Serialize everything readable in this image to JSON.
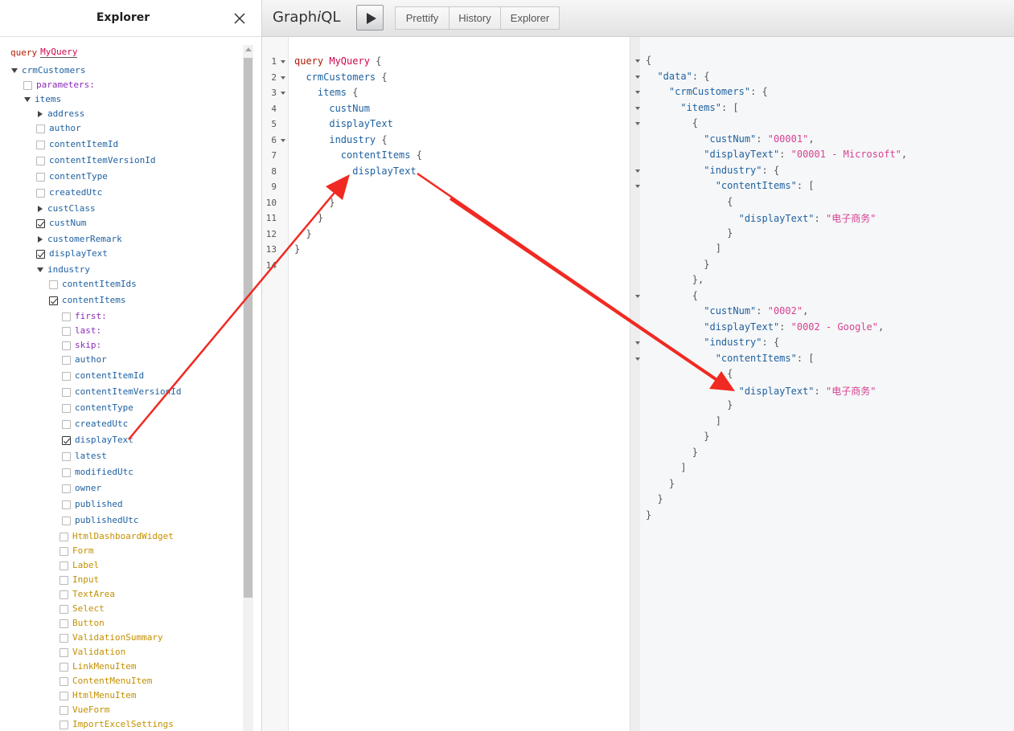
{
  "explorer": {
    "title": "Explorer",
    "query_keyword": "query",
    "query_name": "MyQuery",
    "tree": [
      {
        "label": "crmCustomers",
        "kind": "root-open",
        "depth": 0
      },
      {
        "label": "parameters:",
        "kind": "arg",
        "depth": 1,
        "checked": false
      },
      {
        "label": "items",
        "kind": "open",
        "depth": 1
      },
      {
        "label": "address",
        "kind": "closed",
        "depth": 2
      },
      {
        "label": "author",
        "kind": "field",
        "depth": 2,
        "checked": false
      },
      {
        "label": "contentItemId",
        "kind": "field",
        "depth": 2,
        "checked": false
      },
      {
        "label": "contentItemVersionId",
        "kind": "field",
        "depth": 2,
        "checked": false
      },
      {
        "label": "contentType",
        "kind": "field",
        "depth": 2,
        "checked": false
      },
      {
        "label": "createdUtc",
        "kind": "field",
        "depth": 2,
        "checked": false
      },
      {
        "label": "custClass",
        "kind": "closed",
        "depth": 2
      },
      {
        "label": "custNum",
        "kind": "field",
        "depth": 2,
        "checked": true
      },
      {
        "label": "customerRemark",
        "kind": "closed",
        "depth": 2
      },
      {
        "label": "displayText",
        "kind": "field",
        "depth": 2,
        "checked": true
      },
      {
        "label": "industry",
        "kind": "open",
        "depth": 2
      },
      {
        "label": "contentItemIds",
        "kind": "field",
        "depth": 3,
        "checked": false
      },
      {
        "label": "contentItems",
        "kind": "field",
        "depth": 3,
        "checked": true
      },
      {
        "label": "first:",
        "kind": "arg",
        "depth": 4,
        "checked": false
      },
      {
        "label": "last:",
        "kind": "arg",
        "depth": 4,
        "checked": false
      },
      {
        "label": "skip:",
        "kind": "arg",
        "depth": 4,
        "checked": false
      },
      {
        "label": "author",
        "kind": "field",
        "depth": 4,
        "checked": false
      },
      {
        "label": "contentItemId",
        "kind": "field",
        "depth": 4,
        "checked": false
      },
      {
        "label": "contentItemVersionId",
        "kind": "field",
        "depth": 4,
        "checked": false
      },
      {
        "label": "contentType",
        "kind": "field",
        "depth": 4,
        "checked": false
      },
      {
        "label": "createdUtc",
        "kind": "field",
        "depth": 4,
        "checked": false
      },
      {
        "label": "displayText",
        "kind": "field",
        "depth": 4,
        "checked": true
      },
      {
        "label": "latest",
        "kind": "field",
        "depth": 4,
        "checked": false
      },
      {
        "label": "modifiedUtc",
        "kind": "field",
        "depth": 4,
        "checked": false
      },
      {
        "label": "owner",
        "kind": "field",
        "depth": 4,
        "checked": false
      },
      {
        "label": "published",
        "kind": "field",
        "depth": 4,
        "checked": false
      },
      {
        "label": "publishedUtc",
        "kind": "field",
        "depth": 4,
        "checked": false
      },
      {
        "label": "HtmlDashboardWidget",
        "kind": "frag",
        "depth": 3,
        "checked": false
      },
      {
        "label": "Form",
        "kind": "frag",
        "depth": 3,
        "checked": false
      },
      {
        "label": "Label",
        "kind": "frag",
        "depth": 3,
        "checked": false
      },
      {
        "label": "Input",
        "kind": "frag",
        "depth": 3,
        "checked": false
      },
      {
        "label": "TextArea",
        "kind": "frag",
        "depth": 3,
        "checked": false
      },
      {
        "label": "Select",
        "kind": "frag",
        "depth": 3,
        "checked": false
      },
      {
        "label": "Button",
        "kind": "frag",
        "depth": 3,
        "checked": false
      },
      {
        "label": "ValidationSummary",
        "kind": "frag",
        "depth": 3,
        "checked": false
      },
      {
        "label": "Validation",
        "kind": "frag",
        "depth": 3,
        "checked": false
      },
      {
        "label": "LinkMenuItem",
        "kind": "frag",
        "depth": 3,
        "checked": false
      },
      {
        "label": "ContentMenuItem",
        "kind": "frag",
        "depth": 3,
        "checked": false
      },
      {
        "label": "HtmlMenuItem",
        "kind": "frag",
        "depth": 3,
        "checked": false
      },
      {
        "label": "VueForm",
        "kind": "frag",
        "depth": 3,
        "checked": false
      },
      {
        "label": "ImportExcelSettings",
        "kind": "frag",
        "depth": 3,
        "checked": false
      }
    ]
  },
  "toolbar": {
    "brand_prefix": "Graph",
    "brand_italic": "i",
    "brand_suffix": "QL",
    "prettify_label": "Prettify",
    "history_label": "History",
    "explorer_label": "Explorer"
  },
  "editor": {
    "line_numbers": [
      "1",
      "2",
      "3",
      "4",
      "5",
      "6",
      "7",
      "8",
      "9",
      "10",
      "11",
      "12",
      "13",
      "14"
    ],
    "lines": [
      [
        {
          "t": "query",
          "c": "kw"
        },
        {
          "t": " ",
          "c": "punc"
        },
        {
          "t": "MyQuery",
          "c": "def"
        },
        {
          "t": " {",
          "c": "punc"
        }
      ],
      [
        {
          "t": "  ",
          "c": "punc"
        },
        {
          "t": "crmCustomers",
          "c": "prop"
        },
        {
          "t": " {",
          "c": "punc"
        }
      ],
      [
        {
          "t": "    ",
          "c": "punc"
        },
        {
          "t": "items",
          "c": "prop"
        },
        {
          "t": " {",
          "c": "punc"
        }
      ],
      [
        {
          "t": "      ",
          "c": "punc"
        },
        {
          "t": "custNum",
          "c": "prop"
        }
      ],
      [
        {
          "t": "      ",
          "c": "punc"
        },
        {
          "t": "displayText",
          "c": "prop"
        }
      ],
      [
        {
          "t": "      ",
          "c": "punc"
        },
        {
          "t": "industry",
          "c": "prop"
        },
        {
          "t": " {",
          "c": "punc"
        }
      ],
      [
        {
          "t": "        ",
          "c": "punc"
        },
        {
          "t": "contentItems",
          "c": "prop"
        },
        {
          "t": " {",
          "c": "punc"
        }
      ],
      [
        {
          "t": "          ",
          "c": "punc"
        },
        {
          "t": "displayText",
          "c": "prop"
        }
      ],
      [
        {
          "t": "        }",
          "c": "punc"
        }
      ],
      [
        {
          "t": "      }",
          "c": "punc"
        }
      ],
      [
        {
          "t": "    }",
          "c": "punc"
        }
      ],
      [
        {
          "t": "  }",
          "c": "punc"
        }
      ],
      [
        {
          "t": "}",
          "c": "punc"
        }
      ],
      [
        {
          "t": "",
          "c": "punc"
        }
      ]
    ]
  },
  "result": {
    "lines": [
      [
        {
          "t": "{",
          "c": "p"
        }
      ],
      [
        {
          "t": "  ",
          "c": "p"
        },
        {
          "t": "\"data\"",
          "c": "k"
        },
        {
          "t": ": {",
          "c": "p"
        }
      ],
      [
        {
          "t": "    ",
          "c": "p"
        },
        {
          "t": "\"crmCustomers\"",
          "c": "k"
        },
        {
          "t": ": {",
          "c": "p"
        }
      ],
      [
        {
          "t": "      ",
          "c": "p"
        },
        {
          "t": "\"items\"",
          "c": "k"
        },
        {
          "t": ": [",
          "c": "p"
        }
      ],
      [
        {
          "t": "        {",
          "c": "p"
        }
      ],
      [
        {
          "t": "          ",
          "c": "p"
        },
        {
          "t": "\"custNum\"",
          "c": "k"
        },
        {
          "t": ": ",
          "c": "p"
        },
        {
          "t": "\"00001\"",
          "c": "s"
        },
        {
          "t": ",",
          "c": "p"
        }
      ],
      [
        {
          "t": "          ",
          "c": "p"
        },
        {
          "t": "\"displayText\"",
          "c": "k"
        },
        {
          "t": ": ",
          "c": "p"
        },
        {
          "t": "\"00001 - Microsoft\"",
          "c": "s"
        },
        {
          "t": ",",
          "c": "p"
        }
      ],
      [
        {
          "t": "          ",
          "c": "p"
        },
        {
          "t": "\"industry\"",
          "c": "k"
        },
        {
          "t": ": {",
          "c": "p"
        }
      ],
      [
        {
          "t": "            ",
          "c": "p"
        },
        {
          "t": "\"contentItems\"",
          "c": "k"
        },
        {
          "t": ": [",
          "c": "p"
        }
      ],
      [
        {
          "t": "              {",
          "c": "p"
        }
      ],
      [
        {
          "t": "                ",
          "c": "p"
        },
        {
          "t": "\"displayText\"",
          "c": "k"
        },
        {
          "t": ": ",
          "c": "p"
        },
        {
          "t": "\"电子商务\"",
          "c": "s"
        }
      ],
      [
        {
          "t": "              }",
          "c": "p"
        }
      ],
      [
        {
          "t": "            ]",
          "c": "p"
        }
      ],
      [
        {
          "t": "          }",
          "c": "p"
        }
      ],
      [
        {
          "t": "        },",
          "c": "p"
        }
      ],
      [
        {
          "t": "        {",
          "c": "p"
        }
      ],
      [
        {
          "t": "          ",
          "c": "p"
        },
        {
          "t": "\"custNum\"",
          "c": "k"
        },
        {
          "t": ": ",
          "c": "p"
        },
        {
          "t": "\"0002\"",
          "c": "s"
        },
        {
          "t": ",",
          "c": "p"
        }
      ],
      [
        {
          "t": "          ",
          "c": "p"
        },
        {
          "t": "\"displayText\"",
          "c": "k"
        },
        {
          "t": ": ",
          "c": "p"
        },
        {
          "t": "\"0002 - Google\"",
          "c": "s"
        },
        {
          "t": ",",
          "c": "p"
        }
      ],
      [
        {
          "t": "          ",
          "c": "p"
        },
        {
          "t": "\"industry\"",
          "c": "k"
        },
        {
          "t": ": {",
          "c": "p"
        }
      ],
      [
        {
          "t": "            ",
          "c": "p"
        },
        {
          "t": "\"contentItems\"",
          "c": "k"
        },
        {
          "t": ": [",
          "c": "p"
        }
      ],
      [
        {
          "t": "              {",
          "c": "p"
        }
      ],
      [
        {
          "t": "                ",
          "c": "p"
        },
        {
          "t": "\"displayText\"",
          "c": "k"
        },
        {
          "t": ": ",
          "c": "p"
        },
        {
          "t": "\"电子商务\"",
          "c": "s"
        }
      ],
      [
        {
          "t": "              }",
          "c": "p"
        }
      ],
      [
        {
          "t": "            ]",
          "c": "p"
        }
      ],
      [
        {
          "t": "          }",
          "c": "p"
        }
      ],
      [
        {
          "t": "        }",
          "c": "p"
        }
      ],
      [
        {
          "t": "      ]",
          "c": "p"
        }
      ],
      [
        {
          "t": "    }",
          "c": "p"
        }
      ],
      [
        {
          "t": "  }",
          "c": "p"
        }
      ],
      [
        {
          "t": "}",
          "c": "p"
        }
      ]
    ]
  },
  "colors": {
    "annotation_arrow": "#f02a22",
    "keyword": "#b11a04",
    "definition": "#d2054e",
    "property": "#1f61a0",
    "string": "#d64292",
    "fragment": "#c29000",
    "argument": "#8b2bb9"
  }
}
